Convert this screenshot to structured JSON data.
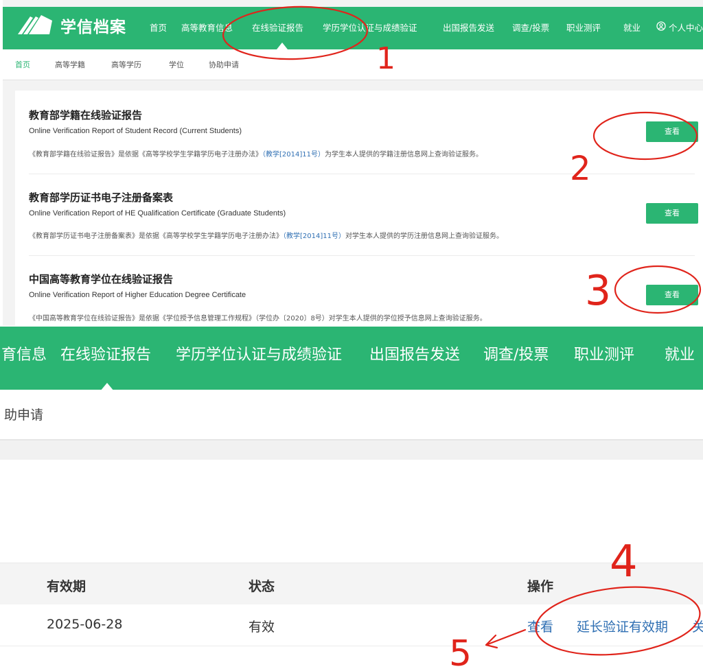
{
  "header": {
    "logo_text": "学信档案",
    "nav": [
      "首页",
      "高等教育信息",
      "在线验证报告",
      "学历学位认证与成绩验证",
      "出国报告发送",
      "调查/投票",
      "职业测评",
      "就业",
      "个人中心"
    ],
    "user_icon": "user-circle-icon"
  },
  "subnav": [
    "首页",
    "高等学籍",
    "高等学历",
    "学位",
    "协助申请"
  ],
  "cards": [
    {
      "title": "教育部学籍在线验证报告",
      "en": "Online Verification Report of Student Record (Current Students)",
      "desc_a": "《教育部学籍在线验证报告》是依据《高等学校学生学籍学历电子注册办法》",
      "desc_link": "（教学[2014]11号）",
      "desc_b": "为学生本人提供的学籍注册信息网上查询验证服务。",
      "button": "查看"
    },
    {
      "title": "教育部学历证书电子注册备案表",
      "en": "Online Verification Report of HE Qualification Certificate (Graduate Students)",
      "desc_a": "《教育部学历证书电子注册备案表》是依据《高等学校学生学籍学历电子注册办法》",
      "desc_link": "（教学[2014]11号）",
      "desc_b": "对学生本人提供的学历注册信息网上查询验证服务。",
      "button": "查看"
    },
    {
      "title": "中国高等教育学位在线验证报告",
      "en": "Online Verification Report of Higher Education Degree Certificate",
      "desc_a": "《中国高等教育学位在线验证报告》是依据《学位授予信息管理工作规程》（学位办〔2020〕8号）对学生本人提供的学位授予信息网上查询验证服务。",
      "desc_link": "",
      "desc_b": "",
      "button": "查看"
    }
  ],
  "zoom_nav": [
    "育信息",
    "在线验证报告",
    "学历学位认证与成绩验证",
    "出国报告发送",
    "调查/投票",
    "职业测评",
    "就业"
  ],
  "zoom_sub": "助申请",
  "table": {
    "headers": [
      "有效期",
      "状态",
      "操作"
    ],
    "row": {
      "expiry": "2025-06-28",
      "status": "有效",
      "actions": [
        "查看",
        "延长验证有效期",
        "关"
      ]
    }
  },
  "annotations": [
    "1",
    "2",
    "3",
    "4",
    "5"
  ],
  "colors": {
    "brand_green": "#2bb573",
    "link_blue": "#2f6fb3",
    "annotation_red": "#e0241b"
  }
}
